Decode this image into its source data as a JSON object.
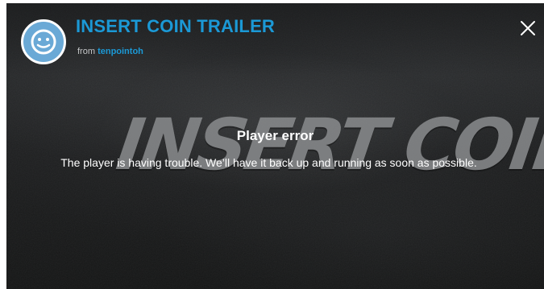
{
  "header": {
    "title": "INSERT COIN TRAILER",
    "from_label": "from",
    "author": "tenpointoh",
    "avatar_icon": "smiley-face-icon",
    "close_icon": "close-icon"
  },
  "background": {
    "logo_text": "INSERT COIN"
  },
  "error": {
    "title": "Player error",
    "message": "The player is having trouble. We’ll have it back up and running as soon as possible."
  },
  "colors": {
    "accent": "#1b99d6",
    "avatar": "#6aa9d6",
    "background": "#1c1d1e",
    "text": "#ffffff"
  }
}
